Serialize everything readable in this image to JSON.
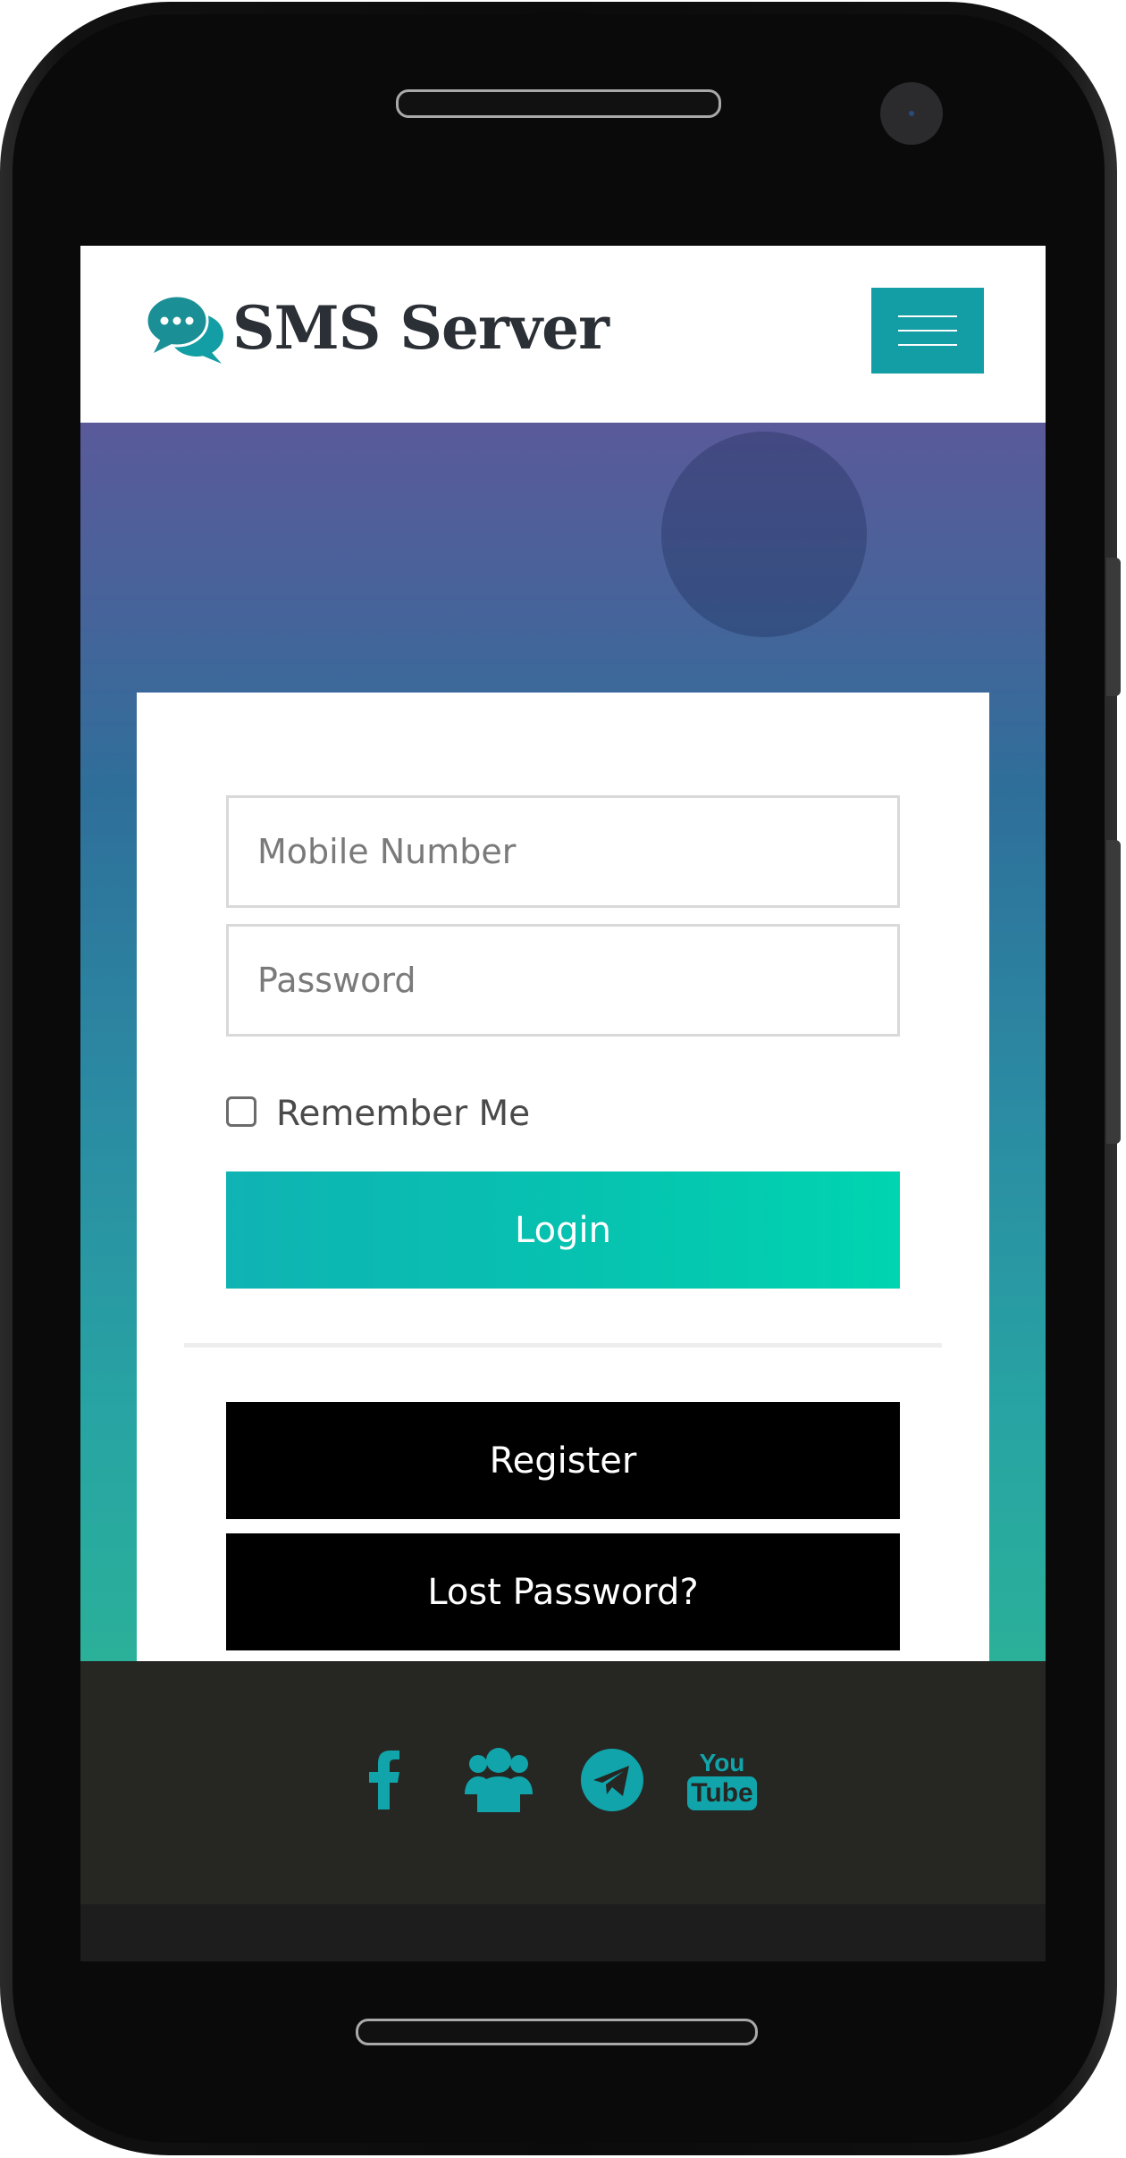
{
  "header": {
    "logo_text": "SMS Server",
    "menu_icon": "hamburger-menu-icon",
    "accent_color": "#129ea4"
  },
  "login_form": {
    "mobile_placeholder": "Mobile Number",
    "password_placeholder": "Password",
    "remember_label": "Remember Me",
    "remember_checked": false,
    "login_label": "Login",
    "register_label": "Register",
    "lost_password_label": "Lost Password?"
  },
  "footer": {
    "social_icons": [
      "facebook-icon",
      "group-icon",
      "telegram-icon",
      "youtube-icon"
    ],
    "youtube_text": [
      "You",
      "Tube"
    ],
    "icon_color": "#11a4ab"
  }
}
